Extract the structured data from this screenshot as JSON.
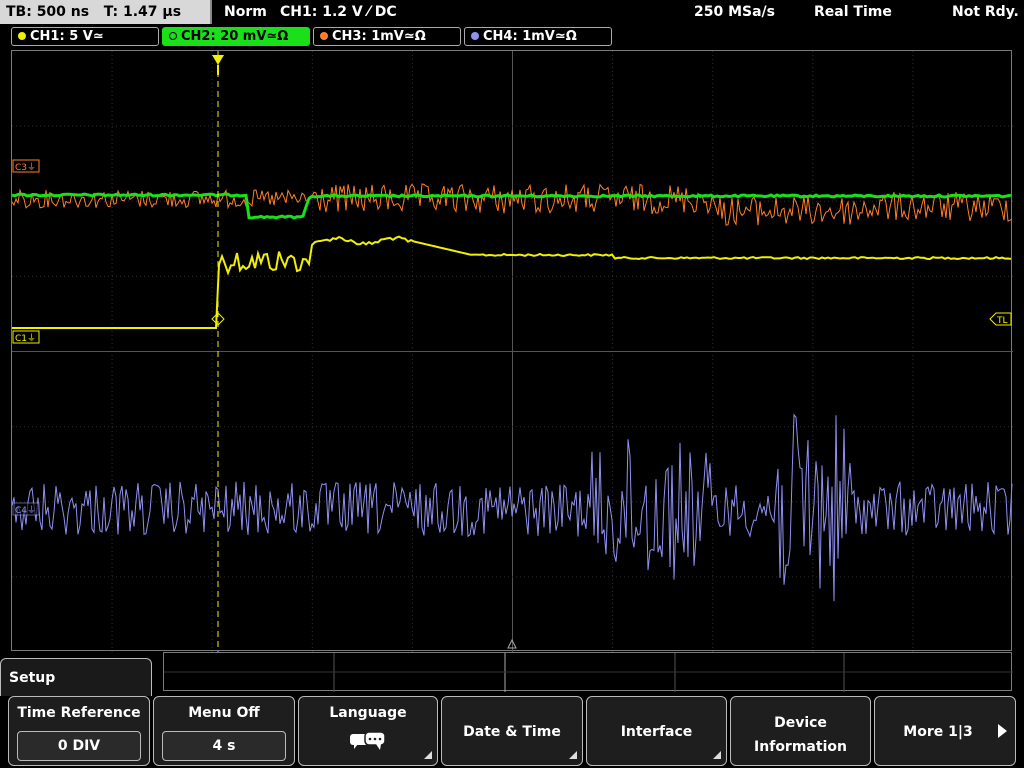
{
  "topbar": {
    "timebase": "TB: 500 ns",
    "trigger_time": "T: 1.47 µs",
    "mode": "Norm",
    "trigger_info": "CH1: 1.2 V ⁄ DC",
    "sample_rate": "250 MSa/s",
    "acq_mode": "Real Time",
    "status": "Not Rdy."
  },
  "channels": [
    {
      "label": "CH1: 5 V≃",
      "color": "#f0f000",
      "active": false
    },
    {
      "label": "CH2: 20 mV≃Ω",
      "color": "#19e019",
      "active": true
    },
    {
      "label": "CH3: 1mV≃Ω",
      "color": "#ff7f2a",
      "active": false
    },
    {
      "label": "CH4: 1mV≃Ω",
      "color": "#9090f0",
      "active": false
    }
  ],
  "markers": {
    "c3": "C3⏚",
    "c1": "C1⏚",
    "c4": "C4⏚",
    "trigger_level": "TL"
  },
  "menu": {
    "title": "Setup",
    "softkeys": [
      {
        "label": "Time Reference",
        "value": "0 DIV"
      },
      {
        "label": "Menu Off",
        "value": "4 s"
      },
      {
        "label": "Language",
        "icon": "speech-bubbles-icon"
      },
      {
        "label": "Date & Time"
      },
      {
        "label": "Interface"
      },
      {
        "label_line1": "Device",
        "label_line2": "Information"
      },
      {
        "label": "More 1|3"
      }
    ]
  }
}
